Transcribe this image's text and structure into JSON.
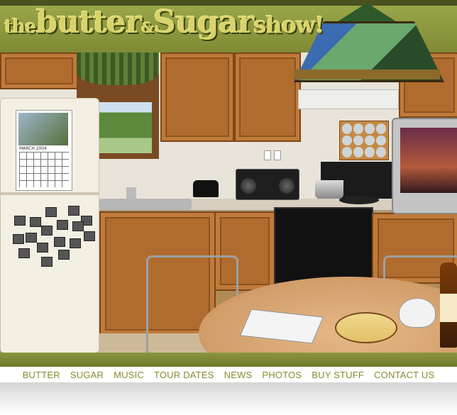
{
  "header": {
    "logo_the": "the",
    "logo_butter": "butter",
    "logo_amp": "&",
    "logo_sugar": "Sugar",
    "logo_show": "show!"
  },
  "calendar": {
    "month": "MARCH 2004"
  },
  "nav": {
    "items": [
      {
        "label": "BUTTER"
      },
      {
        "label": "SUGAR"
      },
      {
        "label": "MUSIC"
      },
      {
        "label": "TOUR DATES"
      },
      {
        "label": "NEWS"
      },
      {
        "label": "PHOTOS"
      },
      {
        "label": "BUY STUFF"
      },
      {
        "label": "CONTACT US"
      }
    ]
  },
  "colors": {
    "olive": "#7f8a33",
    "logo_text": "#d8d36a",
    "nav_text": "#8a8a30",
    "wood": "#b06c2e"
  }
}
